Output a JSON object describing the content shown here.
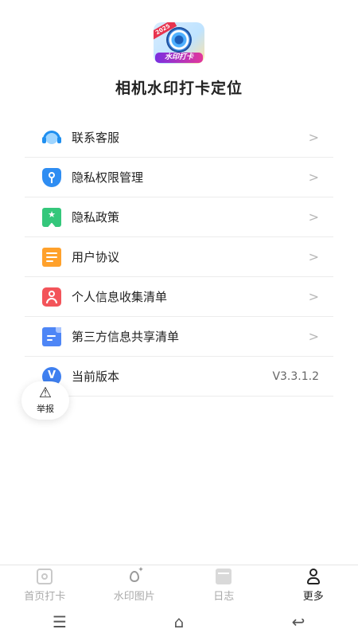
{
  "app": {
    "logo_year": "2025",
    "logo_ribbon": "水印打卡",
    "title": "相机水印打卡定位"
  },
  "menu": {
    "items": [
      {
        "label": "联系客服",
        "icon": "customer-service-icon",
        "action": "chevron"
      },
      {
        "label": "隐私权限管理",
        "icon": "privacy-shield-icon",
        "action": "chevron"
      },
      {
        "label": "隐私政策",
        "icon": "bookmark-star-icon",
        "action": "chevron"
      },
      {
        "label": "用户协议",
        "icon": "document-icon",
        "action": "chevron"
      },
      {
        "label": "个人信息收集清单",
        "icon": "user-info-icon",
        "action": "chevron"
      },
      {
        "label": "第三方信息共享清单",
        "icon": "file-share-icon",
        "action": "chevron"
      },
      {
        "label": "当前版本",
        "icon": "version-icon",
        "value": "V3.3.1.2"
      }
    ],
    "chevron": ">"
  },
  "report": {
    "label": "举报",
    "icon": "warning-icon"
  },
  "tabs": [
    {
      "label": "首页打卡",
      "icon": "camera-icon",
      "active": false
    },
    {
      "label": "水印图片",
      "icon": "watermark-drop-icon",
      "active": false
    },
    {
      "label": "日志",
      "icon": "calendar-icon",
      "active": false
    },
    {
      "label": "更多",
      "icon": "person-icon",
      "active": true
    }
  ],
  "system_nav": {
    "menu": "☰",
    "home": "⌂",
    "back": "↩"
  },
  "colors": {
    "active_tab": "#222222",
    "inactive_tab": "#a9a9a9",
    "divider": "#ececec"
  }
}
